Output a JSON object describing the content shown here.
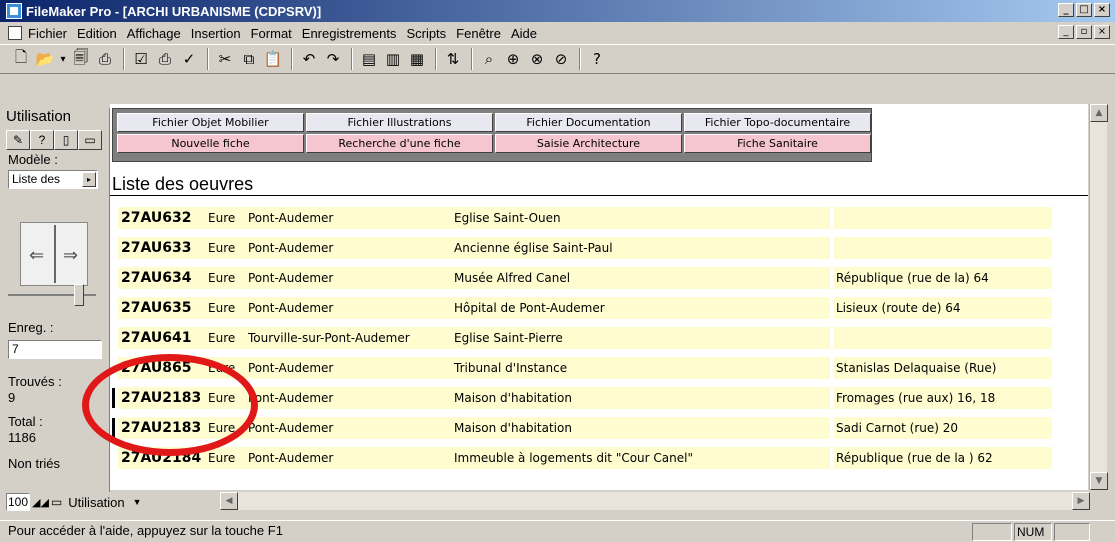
{
  "window": {
    "title": "FileMaker Pro - [ARCHI URBANISME (CDPSRV)]",
    "controls": [
      "_",
      "□",
      "×"
    ],
    "doc_controls": [
      "_",
      "▫",
      "×"
    ]
  },
  "menu": [
    "Fichier",
    "Edition",
    "Affichage",
    "Insertion",
    "Format",
    "Enregistrements",
    "Scripts",
    "Fenêtre",
    "Aide"
  ],
  "status_panel": {
    "mode_title": "Utilisation",
    "model_label": "Modèle :",
    "model_value": "Liste des",
    "record_label": "Enreg. :",
    "record_value": "7",
    "found_label": "Trouvés :",
    "found_value": "9",
    "total_label": "Total :",
    "total_value": "1186",
    "sort_status": "Non triés"
  },
  "nav_buttons": {
    "row1": [
      "Fichier Objet Mobilier",
      "Fichier Illustrations",
      "Fichier Documentation",
      "Fichier Topo-documentaire"
    ],
    "row2": [
      "Nouvelle fiche",
      "Recherche d'une fiche",
      "Saisie Architecture",
      "Fiche Sanitaire"
    ]
  },
  "list_title": "Liste des oeuvres",
  "records": [
    {
      "ref": "27AU632",
      "dep": "Eure",
      "commune": "Pont-Audemer",
      "nom": "Eglise Saint-Ouen",
      "adresse": ""
    },
    {
      "ref": "27AU633",
      "dep": "Eure",
      "commune": "Pont-Audemer",
      "nom": "Ancienne église Saint-Paul",
      "adresse": ""
    },
    {
      "ref": "27AU634",
      "dep": "Eure",
      "commune": "Pont-Audemer",
      "nom": "Musée Alfred Canel",
      "adresse": "République (rue de la) 64"
    },
    {
      "ref": "27AU635",
      "dep": "Eure",
      "commune": "Pont-Audemer",
      "nom": "Hôpital de Pont-Audemer",
      "adresse": "Lisieux (route de) 64"
    },
    {
      "ref": "27AU641",
      "dep": "Eure",
      "commune": "Tourville-sur-Pont-Audemer",
      "nom": "Eglise Saint-Pierre",
      "adresse": ""
    },
    {
      "ref": "27AU865",
      "dep": "Eure",
      "commune": "Pont-Audemer",
      "nom": "Tribunal d'Instance",
      "adresse": "Stanislas Delaquaise (Rue)"
    },
    {
      "ref": "27AU2183",
      "dep": "Eure",
      "commune": "Pont-Audemer",
      "nom": "Maison d'habitation",
      "adresse": "Fromages (rue aux) 16, 18"
    },
    {
      "ref": "27AU2183",
      "dep": "Eure",
      "commune": "Pont-Audemer",
      "nom": "Maison d'habitation",
      "adresse": "Sadi Carnot (rue) 20"
    },
    {
      "ref": "27AU2184",
      "dep": "Eure",
      "commune": "Pont-Audemer",
      "nom": "Immeuble à logements dit \"Cour Canel\"",
      "adresse": "République (rue de la ) 62"
    }
  ],
  "bottom": {
    "zoom": "100",
    "mode_select": "Utilisation"
  },
  "statusbar": {
    "help_text": "Pour accéder à l'aide, appuyez sur la touche F1",
    "num": "NUM"
  },
  "colors": {
    "field_bg": "#fffdd0",
    "highlight": "#e01818",
    "nav_top": "#e8e8f0",
    "nav_bottom": "#f6c6d0"
  }
}
